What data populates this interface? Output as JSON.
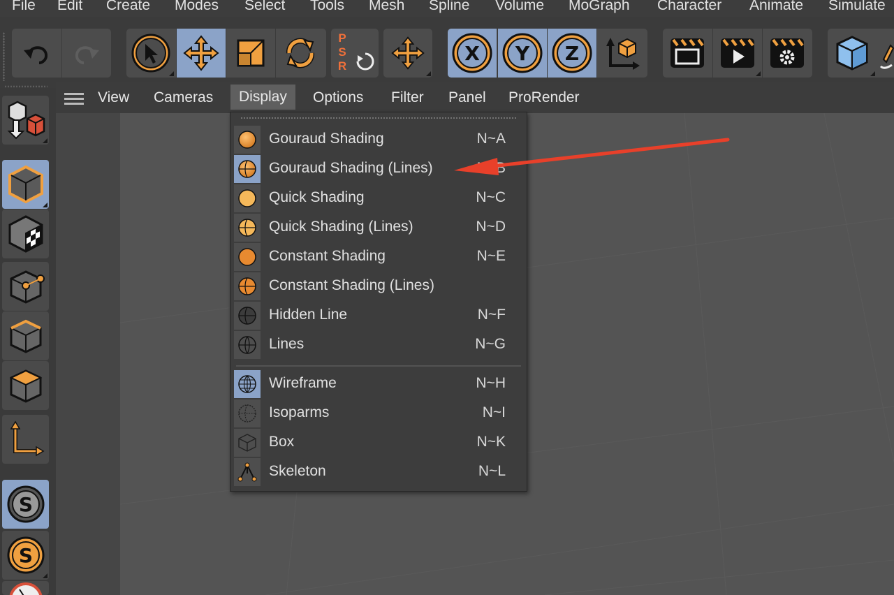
{
  "menubar": {
    "items": [
      "File",
      "Edit",
      "Create",
      "Modes",
      "Select",
      "Tools",
      "Mesh",
      "Spline",
      "Volume",
      "MoGraph",
      "Character",
      "Animate",
      "Simulate"
    ]
  },
  "toolbar": {
    "undo_icon": "undo-icon",
    "redo_icon": "redo-icon",
    "tools": [
      "select-icon",
      "move-icon",
      "scale-icon",
      "rotate-icon"
    ],
    "psr_label": "PSR",
    "axis_labels": [
      "X",
      "Y",
      "Z"
    ],
    "world_coord_icon": "coordinate-system-icon",
    "render_icons": [
      "render-view-icon",
      "render-to-picture-viewer-icon",
      "render-settings-icon"
    ],
    "object_icon": "cube-icon"
  },
  "viewport_menu": {
    "items": [
      "View",
      "Cameras",
      "Display",
      "Options",
      "Filter",
      "Panel",
      "ProRender"
    ],
    "active": "Display"
  },
  "display_menu": {
    "items": [
      {
        "label": "Gouraud Shading",
        "shortcut": "N~A",
        "icon": "gouraud-shading-icon"
      },
      {
        "label": "Gouraud Shading (Lines)",
        "shortcut": "N~B",
        "icon": "gouraud-shading-lines-icon",
        "selected": true
      },
      {
        "label": "Quick Shading",
        "shortcut": "N~C",
        "icon": "quick-shading-icon"
      },
      {
        "label": "Quick Shading (Lines)",
        "shortcut": "N~D",
        "icon": "quick-shading-lines-icon"
      },
      {
        "label": "Constant Shading",
        "shortcut": "N~E",
        "icon": "constant-shading-icon"
      },
      {
        "label": "Constant Shading (Lines)",
        "shortcut": "",
        "icon": "constant-shading-lines-icon"
      },
      {
        "label": "Hidden Line",
        "shortcut": "N~F",
        "icon": "hidden-line-icon"
      },
      {
        "label": "Lines",
        "shortcut": "N~G",
        "icon": "lines-icon"
      },
      {
        "label": "Wireframe",
        "shortcut": "N~H",
        "icon": "wireframe-icon",
        "selected": true
      },
      {
        "label": "Isoparms",
        "shortcut": "N~I",
        "icon": "isoparms-icon"
      },
      {
        "label": "Box",
        "shortcut": "N~K",
        "icon": "box-icon"
      },
      {
        "label": "Skeleton",
        "shortcut": "N~L",
        "icon": "skeleton-icon"
      }
    ]
  },
  "left_toolbar": {
    "icons": [
      "make-editable-icon",
      "model-mode-icon",
      "texture-mode-icon",
      "points-mode-icon",
      "edges-mode-icon",
      "polygons-mode-icon",
      "axis-mode-icon",
      "snap-icon",
      "snap-settings-icon"
    ],
    "snap_label": "S"
  },
  "colors": {
    "accent_orange": "#f0a040",
    "selection_blue": "#8ba3c8",
    "annotation_red": "#e8402a"
  }
}
